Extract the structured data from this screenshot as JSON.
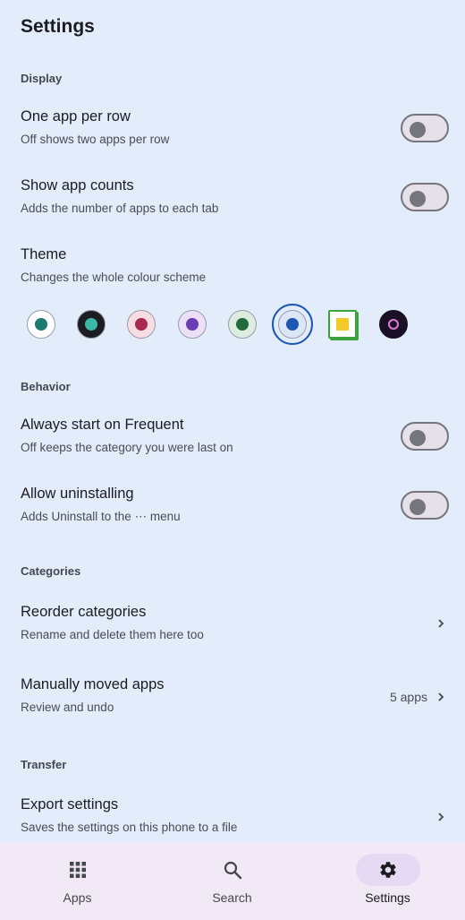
{
  "page": {
    "title": "Settings"
  },
  "sections": {
    "display": "Display",
    "behavior": "Behavior",
    "categories": "Categories",
    "transfer": "Transfer"
  },
  "settings": {
    "one_app_per_row": {
      "title": "One app per row",
      "subtitle": "Off shows two apps per row",
      "on": false
    },
    "show_app_counts": {
      "title": "Show app counts",
      "subtitle": "Adds the number of apps to each tab",
      "on": false
    },
    "theme": {
      "title": "Theme",
      "subtitle": "Changes the whole colour scheme",
      "selected_index": 5,
      "swatches": [
        {
          "bg": "#ffffff",
          "dot": "#1c7a70"
        },
        {
          "bg": "#1c1d22",
          "dot": "#3cb6a6"
        },
        {
          "bg": "#f8dce4",
          "dot": "#a8284e"
        },
        {
          "bg": "#ebe0f7",
          "dot": "#6a3fb6"
        },
        {
          "bg": "#dcecde",
          "dot": "#216a3c"
        },
        {
          "bg": "#dde6f8",
          "dot": "#1c56b3"
        },
        {
          "bg": "#ffffff",
          "dot": "#f5c928",
          "border": "#3aa43a",
          "shape": "square"
        },
        {
          "bg": "#1a0f24",
          "dot": "#e27ad8",
          "shape": "planet"
        }
      ]
    },
    "always_start_frequent": {
      "title": "Always start on Frequent",
      "subtitle": "Off keeps the category you were last on",
      "on": false
    },
    "allow_uninstalling": {
      "title": "Allow uninstalling",
      "subtitle": "Adds Uninstall to the ⋯ menu",
      "on": false
    },
    "reorder_categories": {
      "title": "Reorder categories",
      "subtitle": "Rename and delete them here too"
    },
    "manually_moved_apps": {
      "title": "Manually moved apps",
      "subtitle": "Review and undo",
      "value": "5 apps"
    },
    "export_settings": {
      "title": "Export settings",
      "subtitle": "Saves the settings on this phone to a file"
    }
  },
  "nav": {
    "apps": {
      "label": "Apps",
      "icon": "grid-icon"
    },
    "search": {
      "label": "Search",
      "icon": "search-icon"
    },
    "settings": {
      "label": "Settings",
      "icon": "gear-icon",
      "active": true
    }
  },
  "colors": {
    "background": "#e3ecfb",
    "nav_background": "#f1e9f5",
    "nav_active_pill": "#e6d9f3",
    "selected_ring": "#1c56b3"
  }
}
